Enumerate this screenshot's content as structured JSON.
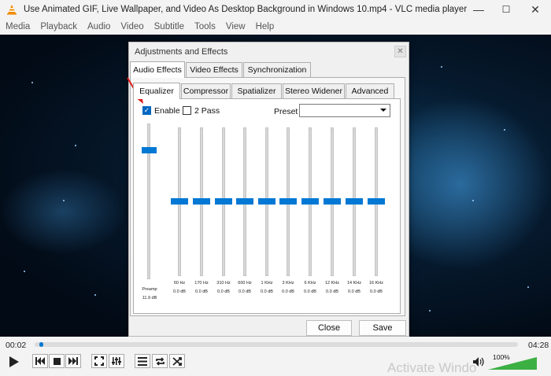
{
  "window": {
    "title": "Use Animated GIF, Live Wallpaper, and Video As Desktop Background in Windows 10.mp4 - VLC media player",
    "controls": [
      "—",
      "☐",
      "✕"
    ]
  },
  "menu": [
    "Media",
    "Playback",
    "Audio",
    "Video",
    "Subtitle",
    "Tools",
    "View",
    "Help"
  ],
  "dialog": {
    "title": "Adjustments and Effects",
    "close": "✕",
    "main_tabs": [
      {
        "label": "Audio Effects",
        "active": true
      },
      {
        "label": "Video Effects",
        "active": false
      },
      {
        "label": "Synchronization",
        "active": false
      }
    ],
    "sub_tabs": [
      {
        "label": "Equalizer",
        "active": true
      },
      {
        "label": "Compressor",
        "active": false
      },
      {
        "label": "Spatializer",
        "active": false
      },
      {
        "label": "Stereo Widener",
        "active": false
      },
      {
        "label": "Advanced",
        "active": false
      }
    ],
    "enable_label": "Enable",
    "enable_checked": true,
    "twopass_label": "2 Pass",
    "twopass_checked": false,
    "preset_label": "Preset",
    "preset_value": "",
    "preamp": {
      "label": "Preamp",
      "value": "11.9 dB",
      "level": 0.85
    },
    "bands": [
      {
        "freq": "60 Hz",
        "value": "0.0 dB"
      },
      {
        "freq": "170 Hz",
        "value": "0.0 dB"
      },
      {
        "freq": "310 Hz",
        "value": "0.0 dB"
      },
      {
        "freq": "600 Hz",
        "value": "0.0 dB"
      },
      {
        "freq": "1 KHz",
        "value": "0.0 dB"
      },
      {
        "freq": "3 KHz",
        "value": "0.0 dB"
      },
      {
        "freq": "6 KHz",
        "value": "0.0 dB"
      },
      {
        "freq": "12 KHz",
        "value": "0.0 dB"
      },
      {
        "freq": "14 KHz",
        "value": "0.0 dB"
      },
      {
        "freq": "16 KHz",
        "value": "0.0 dB"
      }
    ],
    "close_button": "Close",
    "save_button": "Save"
  },
  "player": {
    "elapsed": "00:02",
    "total": "04:28",
    "progress": 0.01,
    "volume": "100%",
    "volume_level": 1.0
  },
  "watermark": "Activate Windo",
  "colors": {
    "accent": "#0078d4",
    "arrow": "#e01b1b",
    "volume_green": "#3cb043"
  }
}
